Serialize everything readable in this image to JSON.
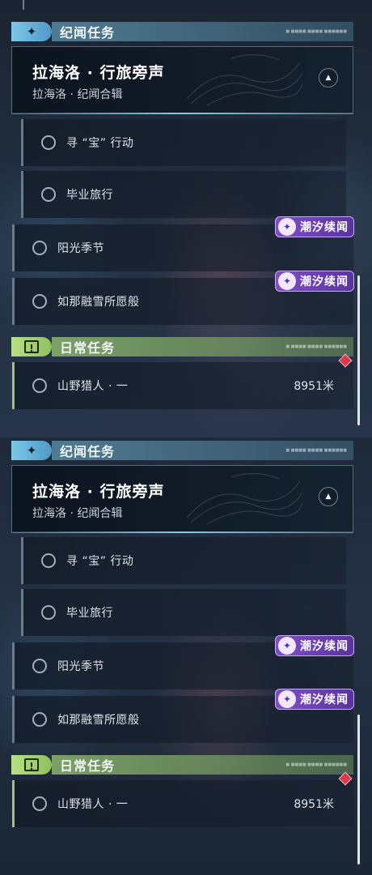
{
  "categories": {
    "story": {
      "title": "纪闻任务",
      "icon": "sparkle-icon",
      "tag": "■ ■■■■ ■■■■ ■■■■■■"
    },
    "daily": {
      "title": "日常任务",
      "icon": "exclamation-box-icon",
      "tag": "■ ■■■■ ■■■■ ■■■■■■"
    }
  },
  "quest_group": {
    "title": "拉海洛 · 行旅旁声",
    "subtitle": "拉海洛 · 纪闻合辑",
    "toggle_icon": "chevron-up-icon"
  },
  "sub_quests": [
    {
      "label": "寻 “宝” 行动"
    },
    {
      "label": "毕业旅行"
    }
  ],
  "story_quests": [
    {
      "label": "阳光季节",
      "badge": "潮汐续闻"
    },
    {
      "label": "如那融雪所愿般",
      "badge": "潮汐续闻"
    }
  ],
  "daily_quests": [
    {
      "label": "山野猎人 · 一",
      "distance": "8951米",
      "marker": "red-diamond-icon"
    }
  ],
  "colors": {
    "story_accent": "#7cc8ea",
    "daily_accent": "#b7e086",
    "badge": "#7e4fc4",
    "marker": "#d9394a"
  }
}
